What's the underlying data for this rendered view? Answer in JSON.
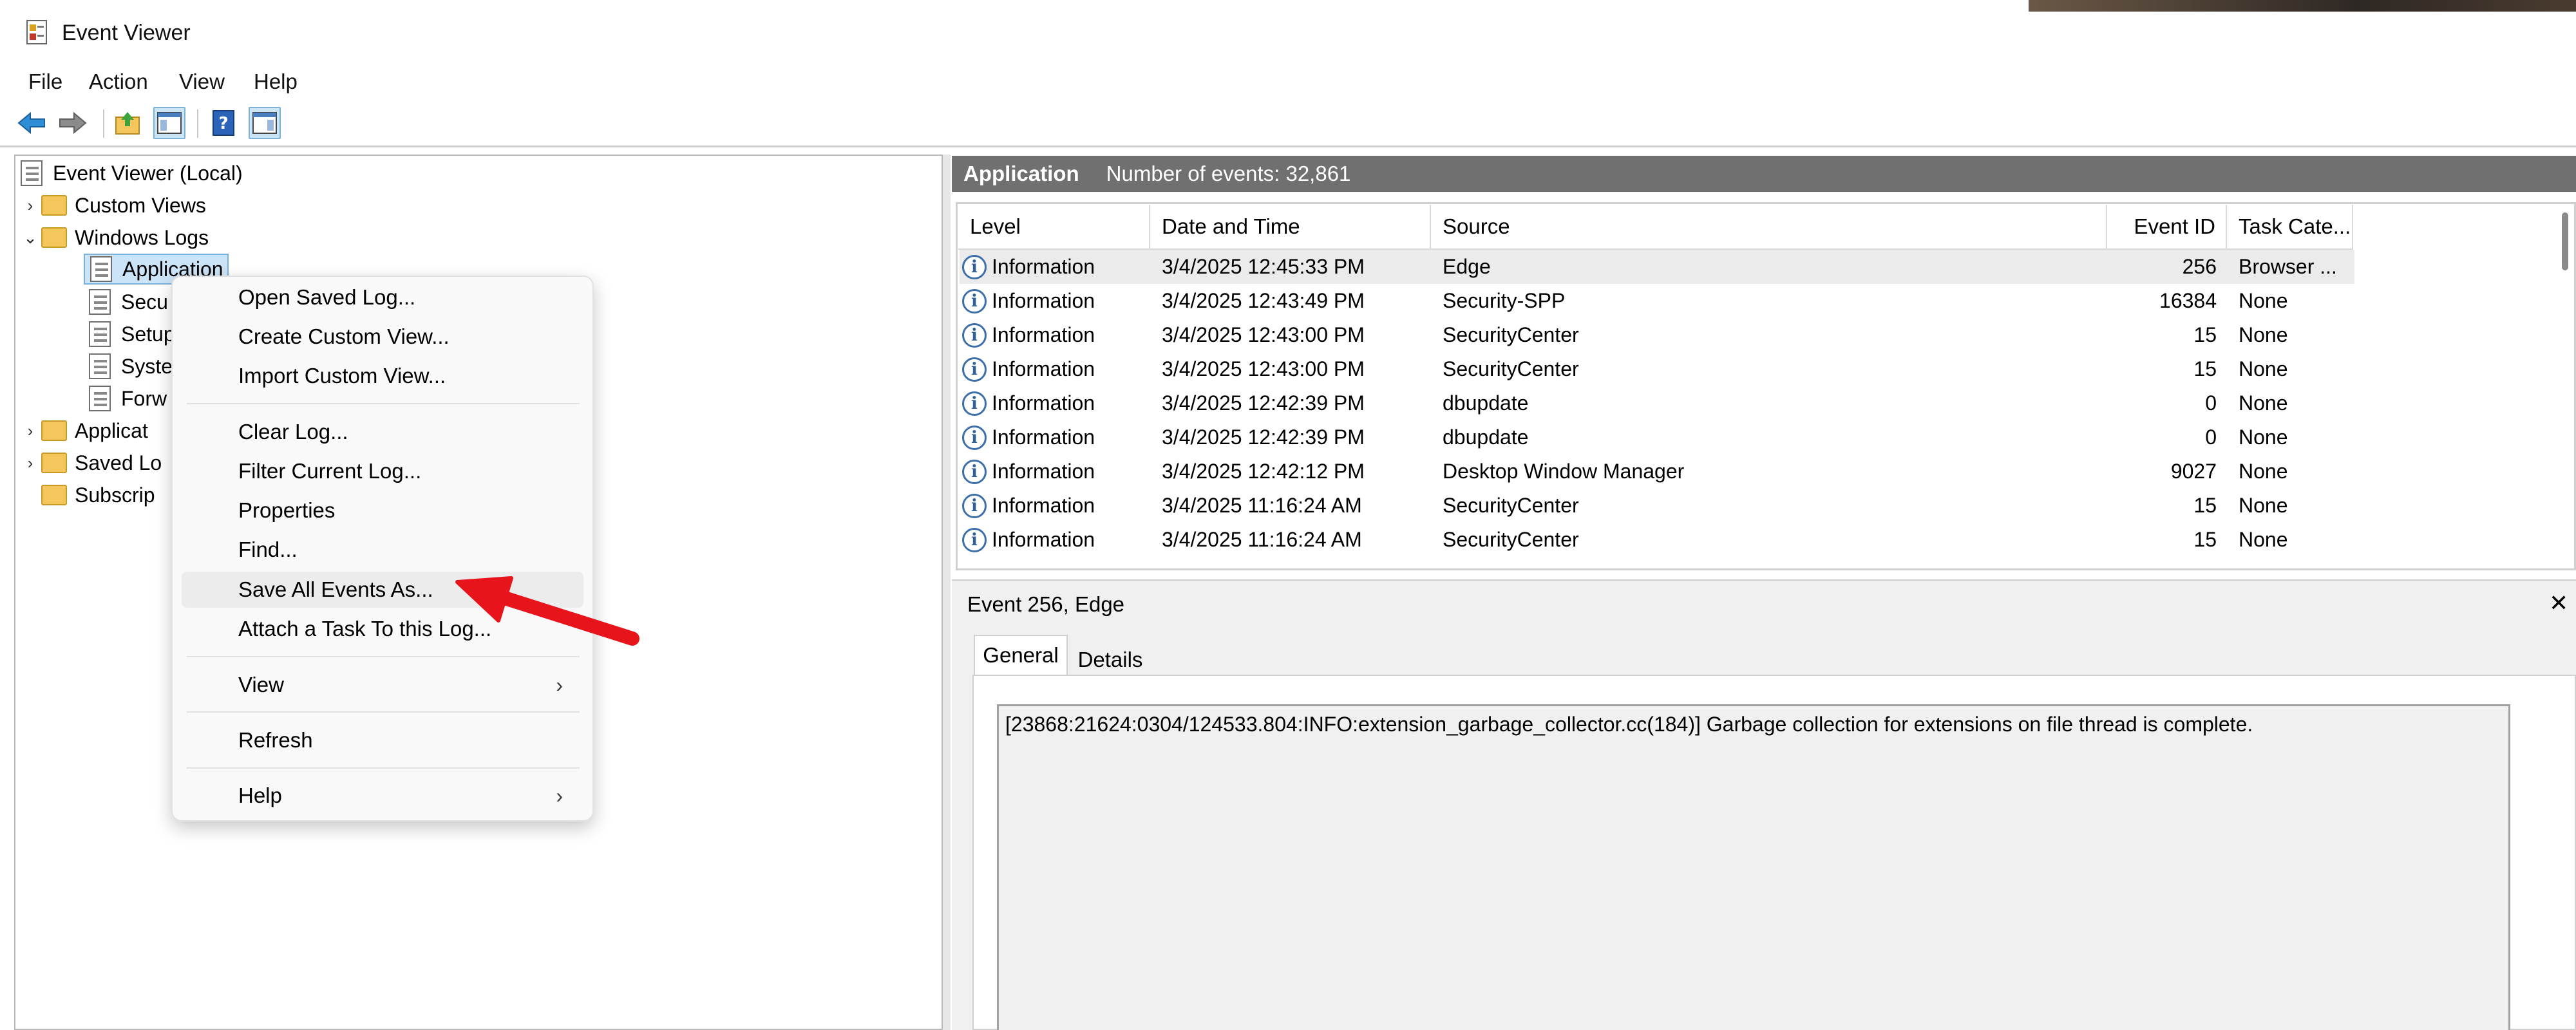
{
  "window": {
    "title": "Event Viewer"
  },
  "menu": [
    "File",
    "Action",
    "View",
    "Help"
  ],
  "tree": {
    "root": "Event Viewer (Local)",
    "custom_views": "Custom Views",
    "windows_logs": "Windows Logs",
    "logs": [
      "Application",
      "Secu",
      "Setup",
      "Syste",
      "Forw"
    ],
    "applications": "Applicat",
    "saved_logs": "Saved Lo",
    "subscriptions": "Subscrip"
  },
  "header": {
    "log_name": "Application",
    "event_count": "Number of events: 32,861"
  },
  "columns": [
    "Level",
    "Date and Time",
    "Source",
    "Event ID",
    "Task Cate..."
  ],
  "events": [
    {
      "level": "Information",
      "date": "3/4/2025 12:45:33 PM",
      "source": "Edge",
      "id": "256",
      "task": "Browser ..."
    },
    {
      "level": "Information",
      "date": "3/4/2025 12:43:49 PM",
      "source": "Security-SPP",
      "id": "16384",
      "task": "None"
    },
    {
      "level": "Information",
      "date": "3/4/2025 12:43:00 PM",
      "source": "SecurityCenter",
      "id": "15",
      "task": "None"
    },
    {
      "level": "Information",
      "date": "3/4/2025 12:43:00 PM",
      "source": "SecurityCenter",
      "id": "15",
      "task": "None"
    },
    {
      "level": "Information",
      "date": "3/4/2025 12:42:39 PM",
      "source": "dbupdate",
      "id": "0",
      "task": "None"
    },
    {
      "level": "Information",
      "date": "3/4/2025 12:42:39 PM",
      "source": "dbupdate",
      "id": "0",
      "task": "None"
    },
    {
      "level": "Information",
      "date": "3/4/2025 12:42:12 PM",
      "source": "Desktop Window Manager",
      "id": "9027",
      "task": "None"
    },
    {
      "level": "Information",
      "date": "3/4/2025 11:16:24 AM",
      "source": "SecurityCenter",
      "id": "15",
      "task": "None"
    },
    {
      "level": "Information",
      "date": "3/4/2025 11:16:24 AM",
      "source": "SecurityCenter",
      "id": "15",
      "task": "None"
    }
  ],
  "detail": {
    "title": "Event 256, Edge",
    "close": "✕",
    "tabs": [
      "General",
      "Details"
    ],
    "message": "[23868:21624:0304/124533.804:INFO:extension_garbage_collector.cc(184)] Garbage collection for extensions on file thread is complete."
  },
  "context_menu": {
    "items": [
      "Open Saved Log...",
      "Create Custom View...",
      "Import Custom View...",
      "Clear Log...",
      "Filter Current Log...",
      "Properties",
      "Find...",
      "Save All Events As...",
      "Attach a Task To this Log...",
      "View",
      "Refresh",
      "Help"
    ],
    "highlighted": "Save All Events As..."
  },
  "colors": {
    "accent": "#0078d4",
    "header_bg": "#707070",
    "selection": "#cce4f7",
    "annotation_arrow": "#e8141c"
  },
  "icons": {
    "back": "back-arrow-icon",
    "forward": "forward-arrow-icon",
    "up": "up-folder-icon",
    "console_tree": "show-hide-console-tree-icon",
    "help": "help-icon",
    "action_pane": "show-hide-action-pane-icon"
  }
}
